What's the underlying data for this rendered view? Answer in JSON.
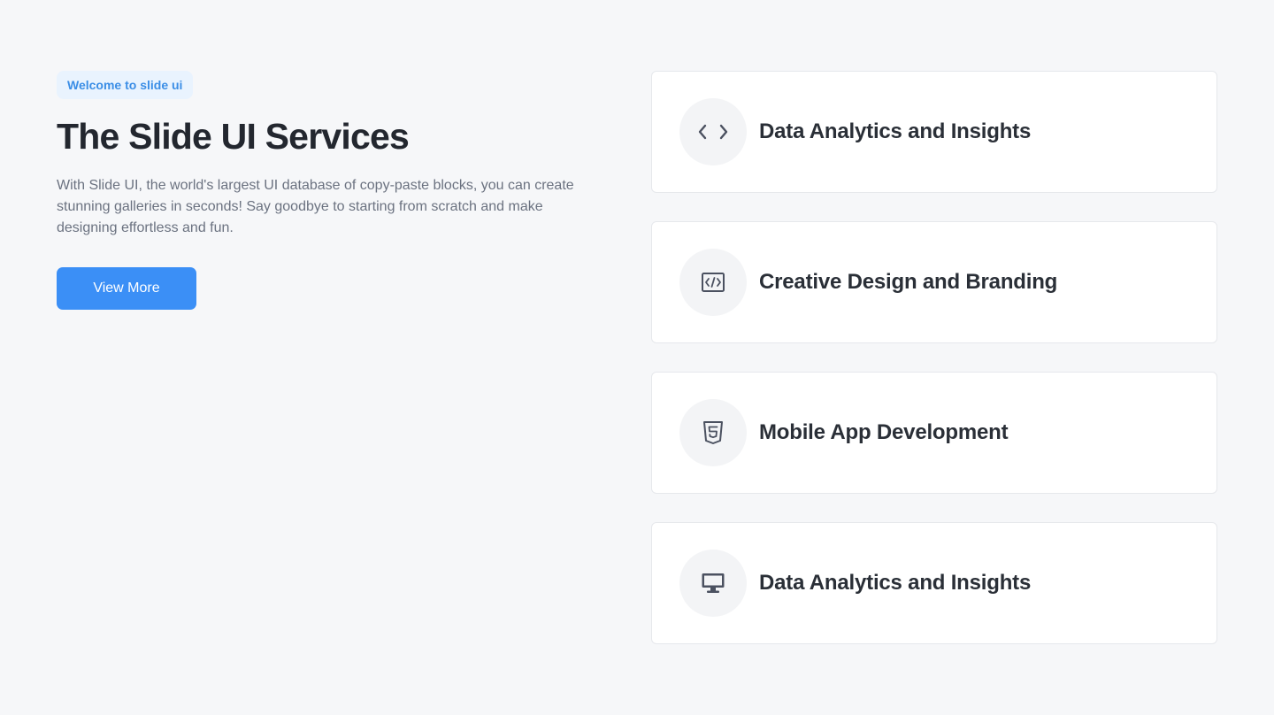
{
  "hero": {
    "badge": "Welcome to slide ui",
    "title": "The Slide UI Services",
    "description": "With Slide UI, the world's largest UI database of copy-paste blocks, you can create stunning galleries in seconds! Say goodbye to starting from scratch and make designing effortless and fun.",
    "button_label": "View More"
  },
  "services": [
    {
      "title": "Data Analytics and Insights",
      "icon": "code-brackets-icon"
    },
    {
      "title": "Creative Design and Branding",
      "icon": "code-file-icon"
    },
    {
      "title": "Mobile App Development",
      "icon": "html5-icon"
    },
    {
      "title": "Data Analytics and Insights",
      "icon": "monitor-icon"
    }
  ],
  "colors": {
    "background": "#f6f7f9",
    "accent": "#3b8ff6",
    "badge_bg": "#e9f3fe",
    "badge_text": "#3b8ee6"
  }
}
